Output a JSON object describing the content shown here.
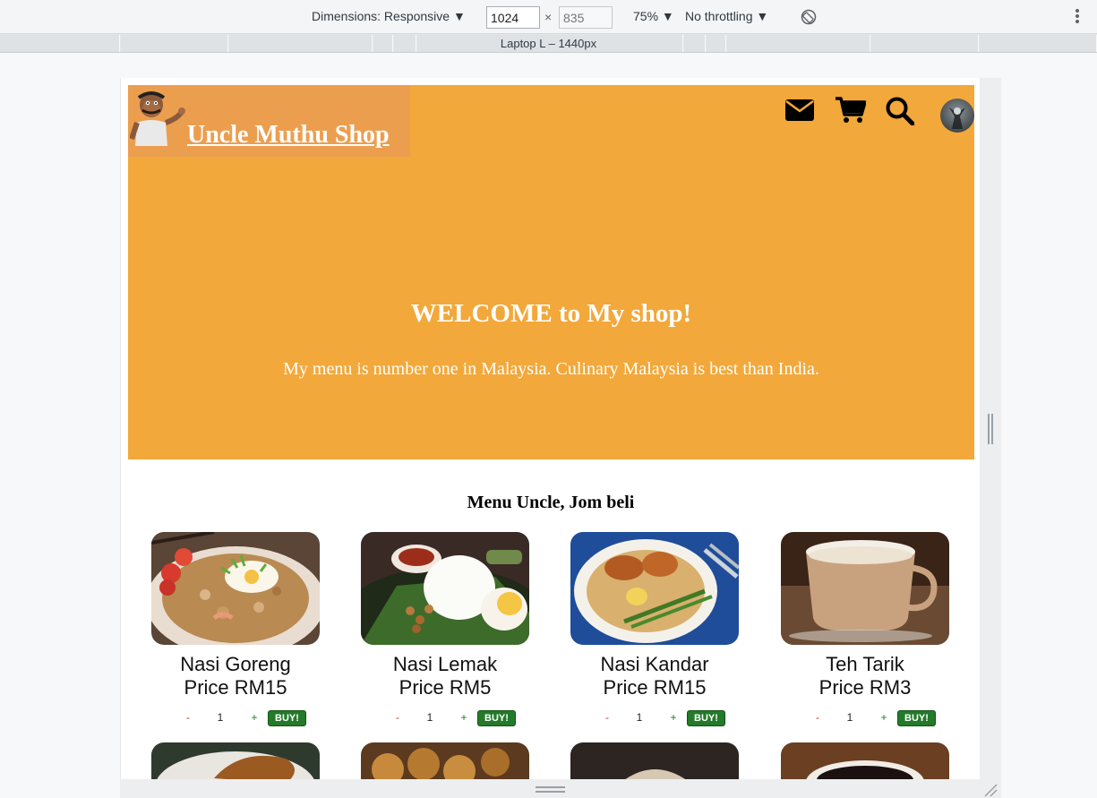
{
  "devtools": {
    "dimensions_label": "Dimensions: Responsive ▼",
    "width_value": "1024",
    "height_placeholder": "835",
    "times": "×",
    "zoom": "75% ▼",
    "throttling": "No throttling ▼",
    "media_label": "Laptop L – 1440px"
  },
  "site": {
    "brand_name": " Uncle Muthu Shop",
    "hero_title": "WELCOME to My shop!",
    "hero_subtitle": "My menu is number one in Malaysia. Culinary Malaysia is best than India.",
    "menu_heading": "Menu Uncle, Jom beli",
    "icons": [
      "envelope-icon",
      "cart-icon",
      "search-icon",
      "avatar"
    ]
  },
  "menu": {
    "items": [
      {
        "name": "Nasi Goreng",
        "price": "Price RM15",
        "qty": "1",
        "minus": "-",
        "plus": "+",
        "buy": "BUY!"
      },
      {
        "name": "Nasi Lemak",
        "price": "Price RM5",
        "qty": "1",
        "minus": "-",
        "plus": "+",
        "buy": "BUY!"
      },
      {
        "name": "Nasi Kandar",
        "price": "Price RM15",
        "qty": "1",
        "minus": "-",
        "plus": "+",
        "buy": "BUY!"
      },
      {
        "name": "Teh Tarik",
        "price": "Price RM3",
        "qty": "1",
        "minus": "-",
        "plus": "+",
        "buy": "BUY!"
      }
    ]
  },
  "colors": {
    "hero_bg": "#f2a83a",
    "brand_bg": "#ec9e4f",
    "buy_button": "#237a2a"
  }
}
